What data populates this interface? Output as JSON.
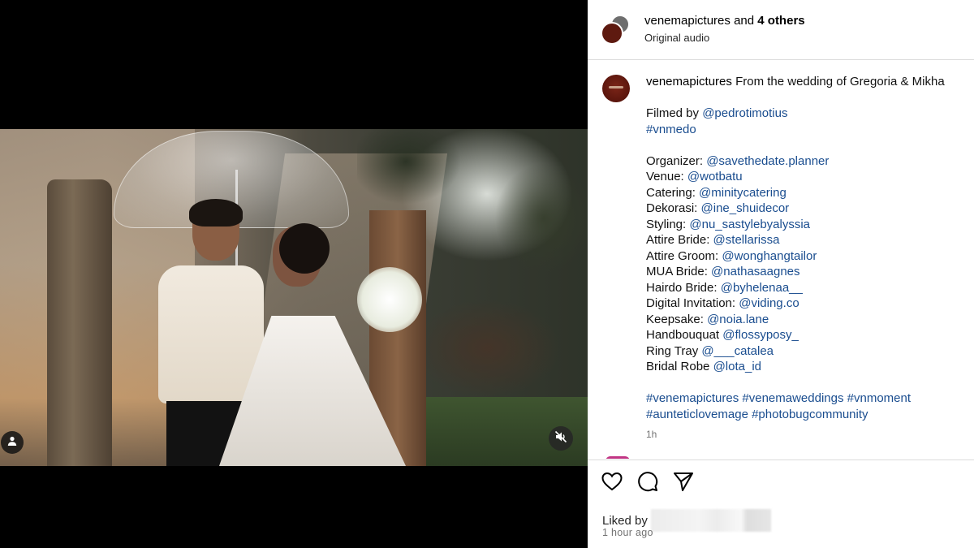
{
  "header": {
    "username": "venemapictures",
    "and_text": "and",
    "others": "4 others",
    "audio": "Original audio"
  },
  "caption": {
    "username": "venemapictures",
    "intro": "From the wedding of Gregoria & Mikha",
    "filmed_label": "Filmed by",
    "filmed_handle": "@pedrotimotius",
    "tag1": "#vnmedo",
    "credits": [
      {
        "label": "Organizer:",
        "handle": "@savethedate.planner"
      },
      {
        "label": "Venue:",
        "handle": "@wotbatu"
      },
      {
        "label": "Catering:",
        "handle": "@minitycatering"
      },
      {
        "label": "Dekorasi:",
        "handle": "@ine_shuidecor"
      },
      {
        "label": "Styling:",
        "handle": "@nu_sastylebyalyssia"
      },
      {
        "label": "Attire Bride:",
        "handle": "@stellarissa"
      },
      {
        "label": "Attire Groom:",
        "handle": "@wonghangtailor"
      },
      {
        "label": "MUA Bride:",
        "handle": "@nathasaagnes"
      },
      {
        "label": "Hairdo Bride:",
        "handle": "@byhelenaa__"
      },
      {
        "label": "Digital Invitation:",
        "handle": "@viding.co"
      },
      {
        "label": "Keepsake:",
        "handle": "@noia.lane"
      },
      {
        "label": "Handbouquat",
        "handle": "@flossyposy_"
      },
      {
        "label": "Ring Tray",
        "handle": "@___catalea"
      },
      {
        "label": "Bridal Robe",
        "handle": "@lota_id"
      }
    ],
    "hashtags_line1": "#venemapictures #venemaweddings #vnmoment",
    "hashtags_line2": "#aunteticlovemage #photobugcommunity",
    "time": "1h"
  },
  "actions": {
    "liked_by": "Liked by",
    "posted": "1 hour ago"
  },
  "icons": {
    "like": "heart-icon",
    "comment": "comment-icon",
    "share": "send-icon",
    "audio": "muted-speaker-icon",
    "tags": "user-tag-icon"
  },
  "colors": {
    "link": "#1a4d8f",
    "muted": "#737373",
    "brand_avatar": "#5e1a10"
  }
}
